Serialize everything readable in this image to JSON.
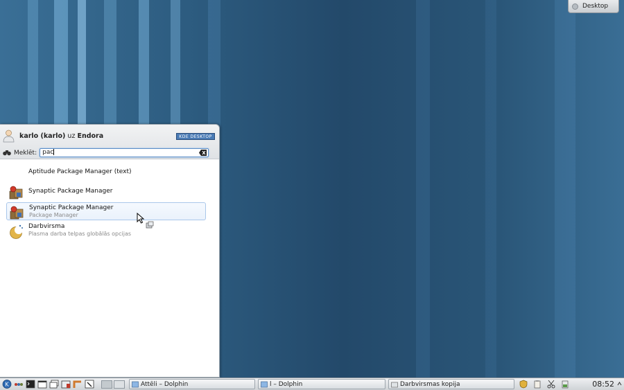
{
  "desktop_toolbox": {
    "label": "Desktop"
  },
  "launcher": {
    "user": {
      "name": "karlo (karlo)",
      "connector": "uz",
      "host": "Endora"
    },
    "kde_logo": {
      "text": "KDE DESKTOP"
    },
    "search": {
      "label": "Meklēt:",
      "value": "pac"
    },
    "results": [
      {
        "name": "Aptitude Package Manager (text)",
        "description": "",
        "icon": "none"
      },
      {
        "name": "Synaptic Package Manager",
        "description": "",
        "icon": "synaptic-icon"
      },
      {
        "name": "Synaptic Package Manager",
        "description": "Package Manager",
        "icon": "synaptic-icon"
      },
      {
        "name": "Darbvirsma",
        "description": "Plasma darba telpas globālās opcijas",
        "icon": "plasma-desktop-icon"
      }
    ]
  },
  "taskbar": {
    "launchers": [
      "kde-menu-icon",
      "dots-icon",
      "terminal-icon",
      "window-icon",
      "window-list-icon",
      "window-stack-icon",
      "panel-icon",
      "tool-icon",
      "desktop-pager-1",
      "desktop-pager-2"
    ],
    "tasks": [
      {
        "label": "Attēli – Dolphin"
      },
      {
        "label": "l – Dolphin"
      },
      {
        "label": "Darbvirsmas kopija"
      }
    ],
    "tray": [
      "shield-icon",
      "clipboard-icon",
      "scissors-icon",
      "battery-icon"
    ],
    "clock": "08:52"
  }
}
